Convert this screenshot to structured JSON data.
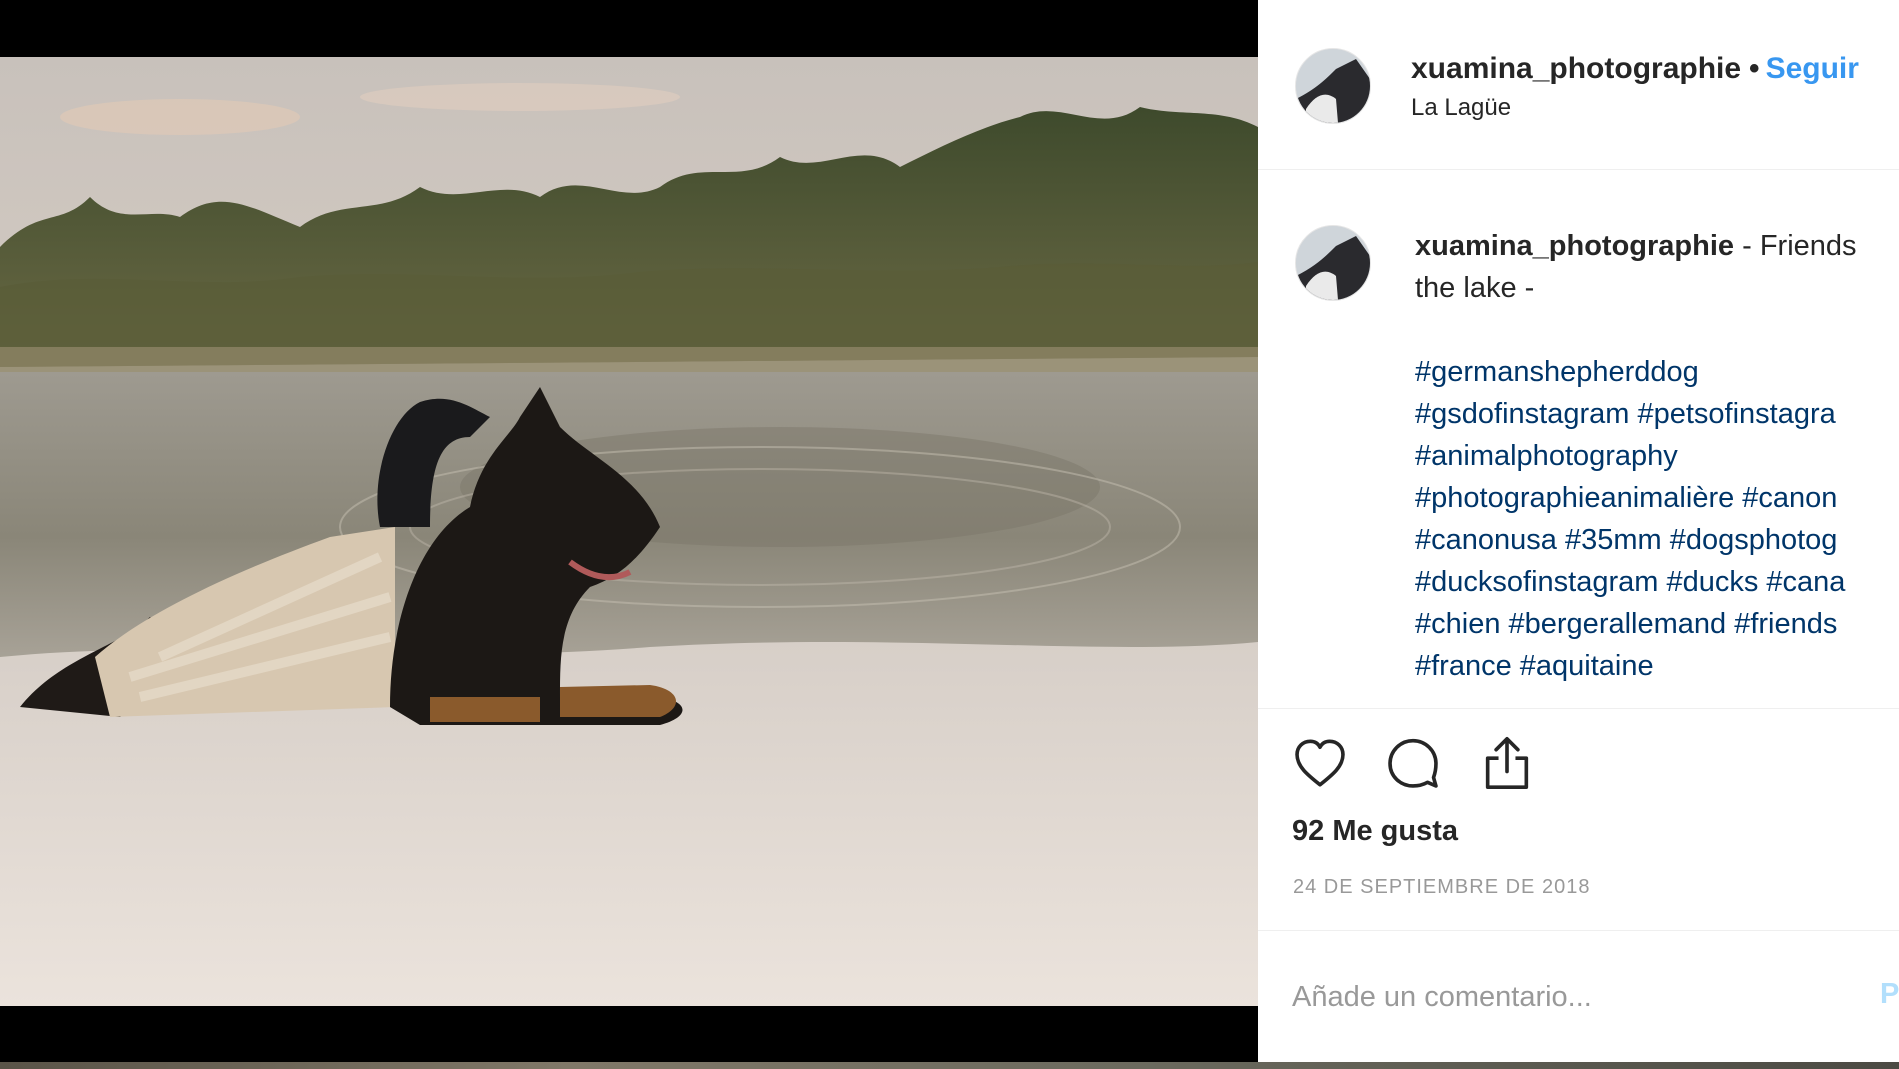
{
  "post": {
    "username": "xuamina_photographie",
    "separator": "•",
    "follow_label": "Seguir",
    "location": "La Lagüe",
    "caption": {
      "username": "xuamina_photographie",
      "line1": " - Friends",
      "line2": "the lake -",
      "hashtag_lines": [
        "#germanshepherddog",
        "#gsdofinstagram #petsofinstagra",
        "#animalphotography",
        "#photographieanimalière #canon",
        "#canonusa #35mm #dogsphotog",
        "#ducksofinstagram #ducks #cana",
        "#chien #bergerallemand #friends",
        "#france #aquitaine"
      ]
    },
    "actions": {
      "like_icon": "heart-icon",
      "comment_icon": "comment-bubble-icon",
      "share_icon": "share-icon"
    },
    "likes": "92 Me gusta",
    "date": "24 de septiembre de 2018",
    "comment_placeholder": "Añade un comentario...",
    "post_button": "P"
  },
  "colors": {
    "link_blue": "#3897f0",
    "hashtag": "#003569",
    "text": "#262626",
    "muted": "#999999"
  }
}
